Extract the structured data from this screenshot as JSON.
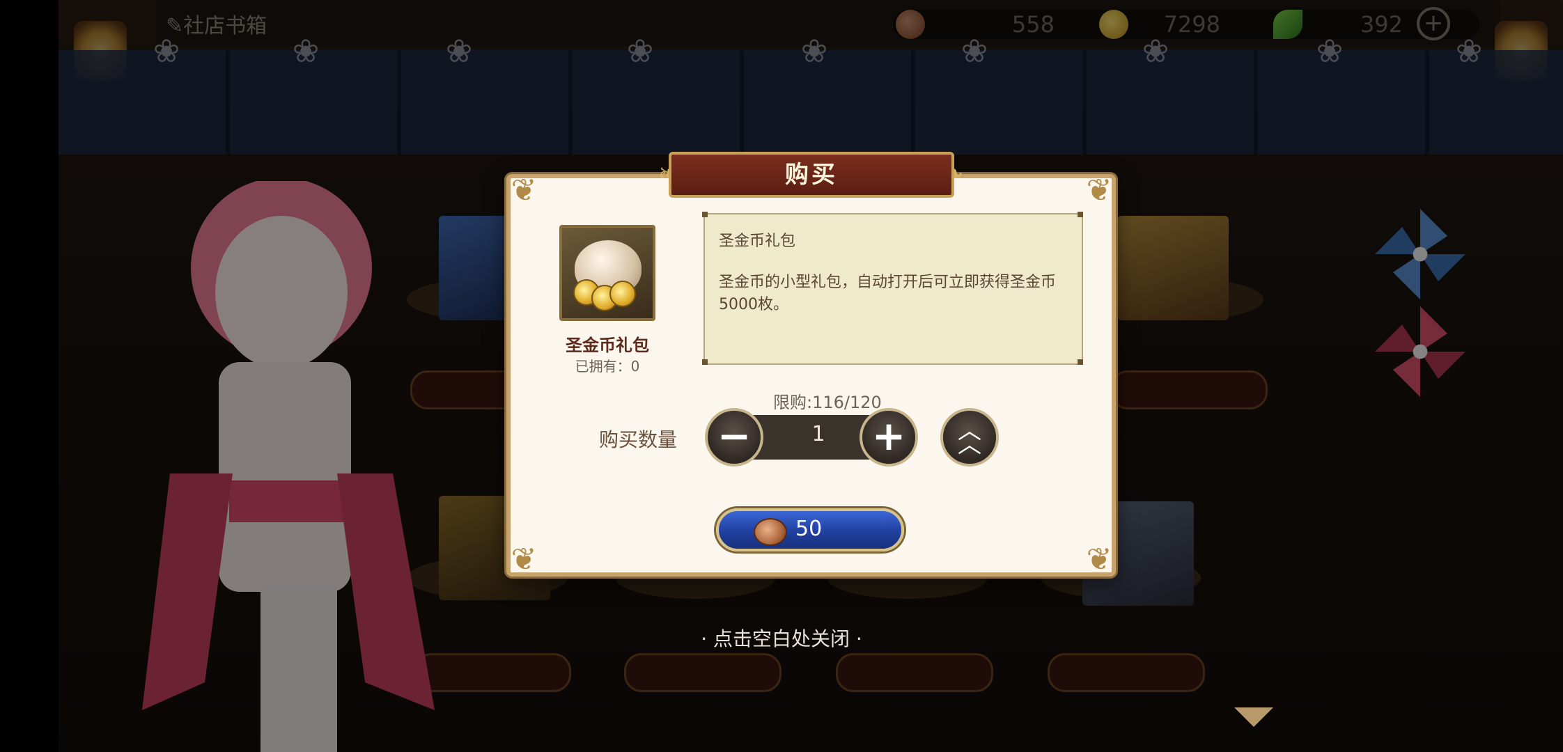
{
  "topbar": {
    "title": "✎社店书箱",
    "resources": [
      {
        "icon": "copper-coin-icon",
        "value": "558"
      },
      {
        "icon": "gold-coin-icon",
        "value": "7298"
      },
      {
        "icon": "leaf-icon",
        "value": "392"
      }
    ]
  },
  "modal": {
    "title": "购买",
    "item_name": "圣金币礼包",
    "owned_label": "已拥有：",
    "owned_count": "0",
    "desc_title": "圣金币礼包",
    "desc_text": "圣金币的小型礼包，自动打开后可立即获得圣金币5000枚。",
    "limit": "限购:116/120",
    "qty_label": "购买数量",
    "qty_value": "1",
    "price": "50"
  },
  "close_hint": "· 点击空白处关闭 ·",
  "colors": {
    "modal_bg": "#fbf7ee",
    "title_bar": "#6b2618",
    "buy_button": "#2a4bb8",
    "gold_trim": "#c7a46c"
  }
}
